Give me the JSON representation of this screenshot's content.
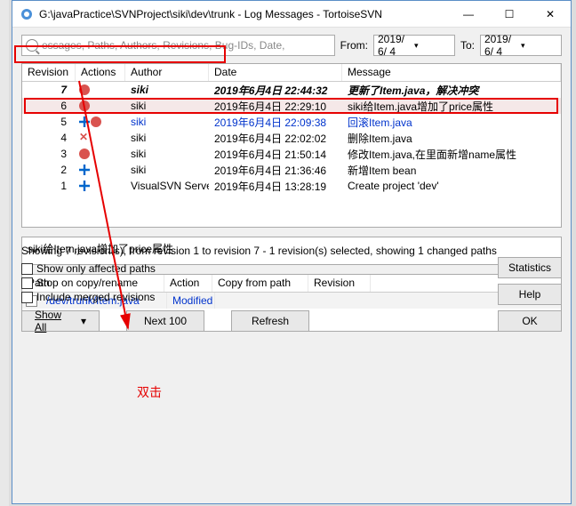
{
  "window": {
    "title": "G:\\javaPractice\\SVNProject\\siki\\dev\\trunk - Log Messages - TortoiseSVN"
  },
  "search": {
    "placeholder": "essages, Paths, Authors, Revisions, Bug-IDs, Date,",
    "from_label": "From:",
    "from_date": "2019/ 6/ 4",
    "to_label": "To:",
    "to_date": "2019/ 6/ 4"
  },
  "log_headers": {
    "revision": "Revision",
    "actions": "Actions",
    "author": "Author",
    "date": "Date",
    "message": "Message"
  },
  "log_rows": [
    {
      "rev": "7",
      "author": "siki",
      "date": "2019年6月4日 22:44:32",
      "msg": "更新了Item.java，解决冲突",
      "bold": true
    },
    {
      "rev": "6",
      "author": "siki",
      "date": "2019年6月4日 22:29:10",
      "msg": "siki给Item.java增加了price属性",
      "sel": true
    },
    {
      "rev": "5",
      "author": "siki",
      "date": "2019年6月4日 22:09:38",
      "msg": "回滚Item.java",
      "blue": true
    },
    {
      "rev": "4",
      "author": "siki",
      "date": "2019年6月4日 22:02:02",
      "msg": "删除Item.java"
    },
    {
      "rev": "3",
      "author": "siki",
      "date": "2019年6月4日 21:50:14",
      "msg": "修改Item.java,在里面新增name属性"
    },
    {
      "rev": "2",
      "author": "siki",
      "date": "2019年6月4日 21:36:46",
      "msg": "新增Item bean"
    },
    {
      "rev": "1",
      "author": "VisualSVN Server",
      "date": "2019年6月4日 13:28:19",
      "msg": "Create project 'dev'"
    }
  ],
  "commit_msg": "siki给Item.java增加了price属性",
  "path_headers": {
    "path": "Path",
    "action": "Action",
    "copy": "Copy from path",
    "revision": "Revision"
  },
  "path_row": {
    "path": "/dev/trunk/Item.java",
    "action": "Modified"
  },
  "annotation": "双击",
  "footer": {
    "status": "Showing 7 revision(s), from revision 1 to revision 7 - 1 revision(s) selected, showing 1 changed paths",
    "chk1": "Show only affected paths",
    "chk2": "Stop on copy/rename",
    "chk3": "Include merged revisions",
    "show_all": "Show All",
    "next_100": "Next 100",
    "refresh": "Refresh",
    "statistics": "Statistics",
    "help": "Help",
    "ok": "OK"
  }
}
